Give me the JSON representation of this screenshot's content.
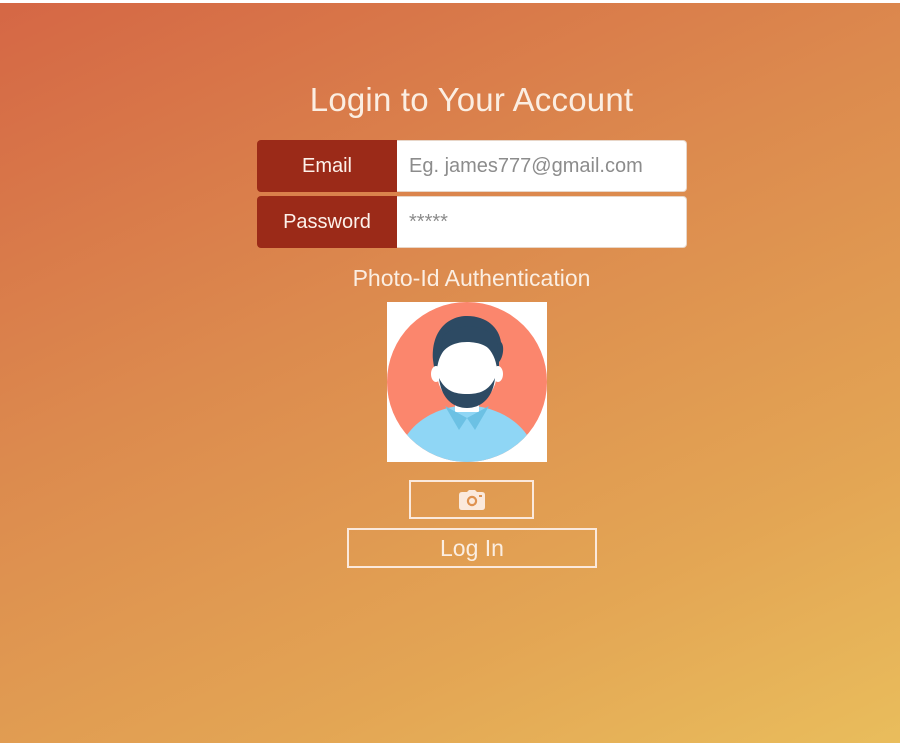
{
  "page": {
    "title": "Login to Your Account"
  },
  "form": {
    "email": {
      "label": "Email",
      "placeholder": "Eg. james777@gmail.com",
      "value": ""
    },
    "password": {
      "label": "Password",
      "placeholder": "*****",
      "value": ""
    }
  },
  "photo_auth": {
    "label": "Photo-Id Authentication",
    "avatar_icon": "user-avatar-icon",
    "camera_icon": "camera-icon"
  },
  "actions": {
    "login_label": "Log In"
  },
  "colors": {
    "label_background": "#9b2a18",
    "gradient_start": "#d56745",
    "gradient_end": "#e9bd5c",
    "text_light": "#fbeee2"
  }
}
